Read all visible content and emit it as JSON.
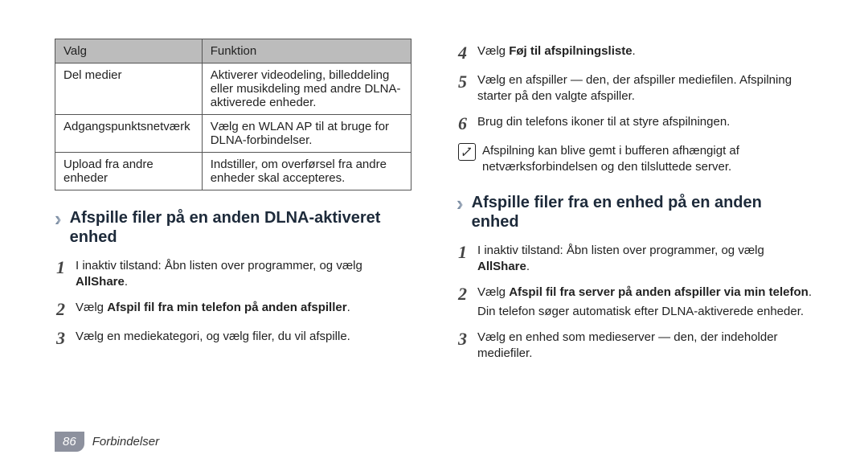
{
  "table": {
    "head": {
      "c0": "Valg",
      "c1": "Funktion"
    },
    "rows": [
      {
        "c0": "Del medier",
        "c1": "Aktiverer videodeling, billeddeling eller musikdeling med andre DLNA-aktiverede enheder."
      },
      {
        "c0": "Adgangspunktsnetværk",
        "c1": "Vælg en WLAN AP til at bruge for DLNA-forbindelser."
      },
      {
        "c0": "Upload fra andre enheder",
        "c1": "Indstiller, om overførsel fra andre enheder skal accepteres."
      }
    ]
  },
  "sectA": {
    "title": "Afspille filer på en anden DLNA-aktiveret enhed",
    "steps": [
      {
        "n": "1",
        "pre": "I inaktiv tilstand: Åbn listen over programmer, og vælg ",
        "bold": "AllShare",
        "post": "."
      },
      {
        "n": "2",
        "pre": "Vælg ",
        "bold": "Afspil fil fra min telefon på anden afspiller",
        "post": "."
      },
      {
        "n": "3",
        "pre": "Vælg en mediekategori, og vælg filer, du vil afspille.",
        "bold": "",
        "post": ""
      }
    ]
  },
  "sectA2": {
    "steps": [
      {
        "n": "4",
        "pre": "Vælg ",
        "bold": "Føj til afspilningsliste",
        "post": "."
      },
      {
        "n": "5",
        "pre": "Vælg en afspiller — den, der afspiller mediefilen. Afspilning starter på den valgte afspiller.",
        "bold": "",
        "post": ""
      },
      {
        "n": "6",
        "pre": "Brug din telefons ikoner til at styre afspilningen.",
        "bold": "",
        "post": ""
      }
    ],
    "note": "Afspilning kan blive gemt i bufferen afhængigt af netværksforbindelsen og den tilsluttede server."
  },
  "sectB": {
    "title": "Afspille filer fra en enhed på en anden enhed",
    "steps": [
      {
        "n": "1",
        "pre": "I inaktiv tilstand: Åbn listen over programmer, og vælg ",
        "bold": "AllShare",
        "post": "."
      },
      {
        "n": "2",
        "pre": "Vælg ",
        "bold": "Afspil fil fra server på anden afspiller via min telefon",
        "post": ".",
        "extra": "Din telefon søger automatisk efter DLNA-aktiverede enheder."
      },
      {
        "n": "3",
        "pre": "Vælg en enhed som medieserver — den, der indeholder mediefiler.",
        "bold": "",
        "post": ""
      }
    ]
  },
  "footer": {
    "page": "86",
    "section": "Forbindelser"
  }
}
